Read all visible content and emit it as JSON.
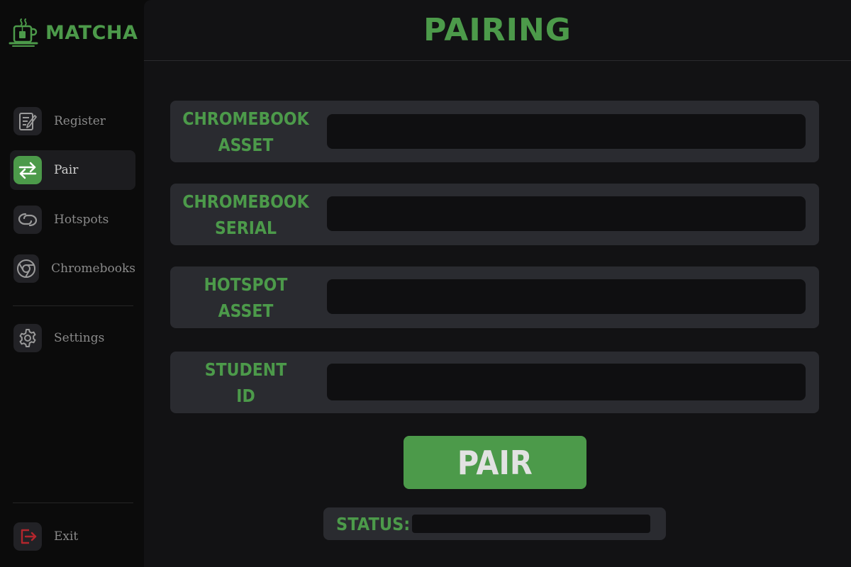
{
  "app": {
    "name": "MATCHA",
    "logo_icon": "teacup-icon"
  },
  "colors": {
    "accent": "#4c9a4a",
    "sidebar_bg": "#0b0b0b",
    "main_bg": "#121214",
    "panel_bg": "#2a2b30",
    "input_bg": "#0f0f11",
    "exit_icon": "#b3262d"
  },
  "sidebar": {
    "items": [
      {
        "label": "Register",
        "icon": "register-icon",
        "active": false
      },
      {
        "label": "Pair",
        "icon": "swap-arrows-icon",
        "active": true
      },
      {
        "label": "Hotspots",
        "icon": "hotspot-icon",
        "active": false
      },
      {
        "label": "Chromebooks",
        "icon": "chrome-icon",
        "active": false
      },
      {
        "label": "Settings",
        "icon": "gear-icon",
        "active": false
      },
      {
        "label": "Exit",
        "icon": "exit-icon",
        "active": false
      }
    ]
  },
  "page": {
    "title": "PAIRING"
  },
  "form": {
    "fields": [
      {
        "label_line1": "CHROMEBOOK",
        "label_line2": "ASSET",
        "value": ""
      },
      {
        "label_line1": "CHROMEBOOK",
        "label_line2": "SERIAL",
        "value": ""
      },
      {
        "label_line1": "HOTSPOT",
        "label_line2": "ASSET",
        "value": ""
      },
      {
        "label_line1": "STUDENT",
        "label_line2": "ID",
        "value": ""
      }
    ],
    "submit_label": "PAIR"
  },
  "status": {
    "label": "STATUS:",
    "value": ""
  }
}
